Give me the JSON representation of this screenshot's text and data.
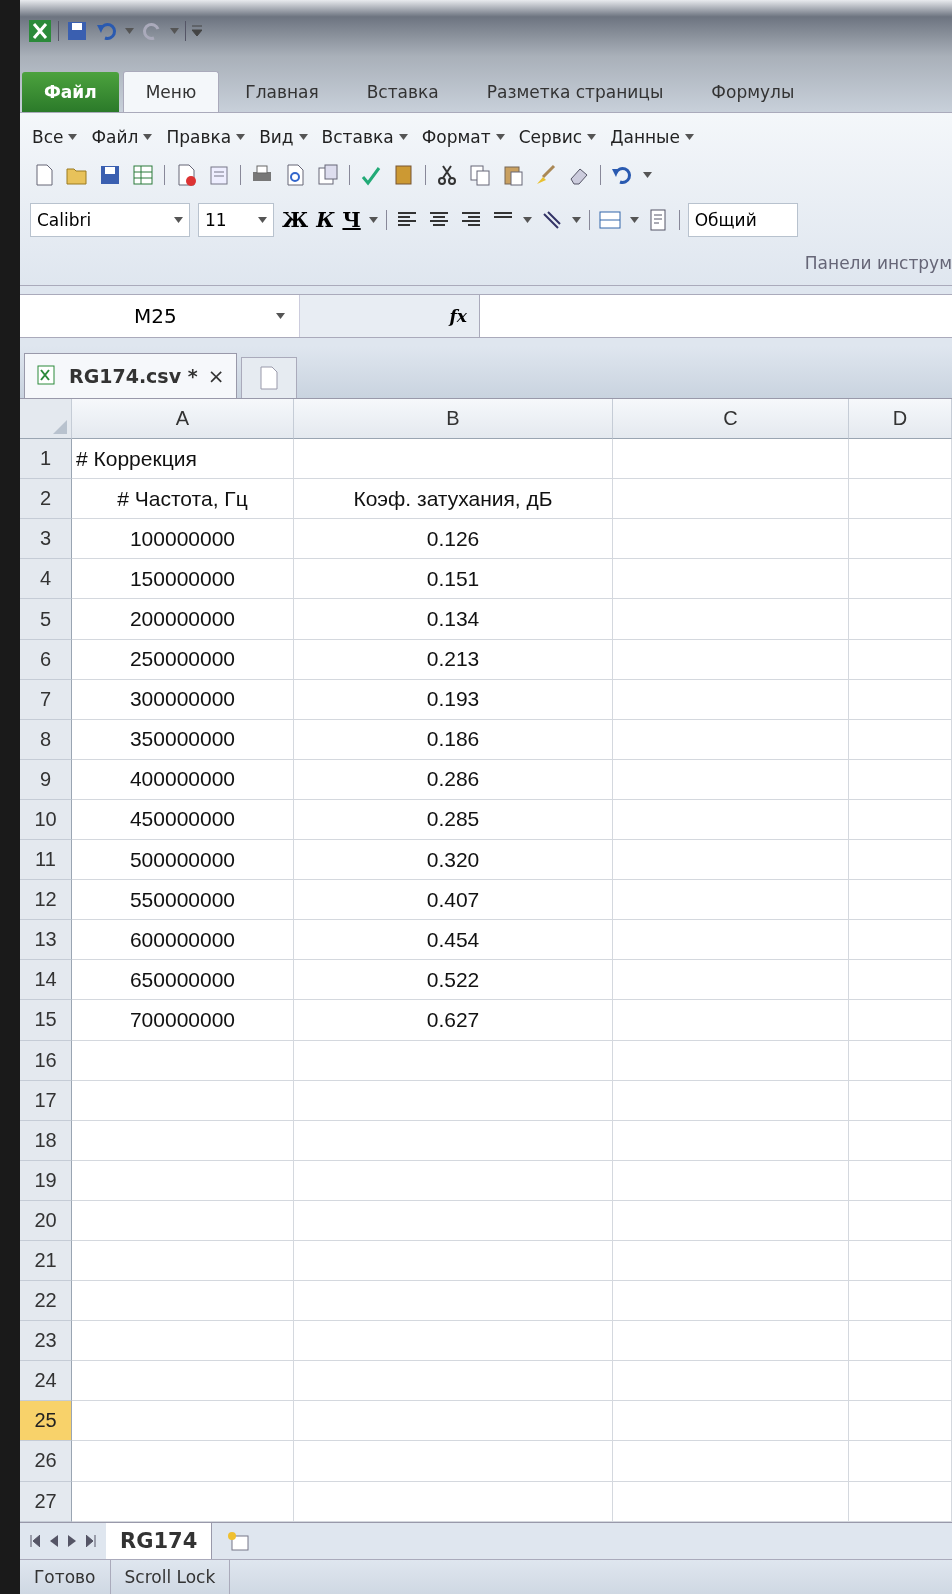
{
  "ribbon_tabs": [
    {
      "label": "Файл",
      "kind": "file",
      "selected": false
    },
    {
      "label": "Меню",
      "kind": "tab",
      "selected": true
    },
    {
      "label": "Главная",
      "kind": "tab",
      "selected": false
    },
    {
      "label": "Вставка",
      "kind": "tab",
      "selected": false
    },
    {
      "label": "Разметка страницы",
      "kind": "tab",
      "selected": false
    },
    {
      "label": "Формулы",
      "kind": "tab",
      "selected": false
    }
  ],
  "menus": [
    "Все",
    "Файл",
    "Правка",
    "Вид",
    "Вставка",
    "Формат",
    "Сервис",
    "Данные"
  ],
  "format_bar": {
    "font": "Calibri",
    "size": "11",
    "bold": "Ж",
    "italic": "К",
    "underline": "Ч",
    "number_format": "Общий"
  },
  "group_label": "Панели инструм",
  "formula_bar": {
    "name_box": "M25",
    "fx": "fx"
  },
  "document_tab": {
    "title": "RG174.csv *",
    "close": "×"
  },
  "columns": [
    {
      "label": "A",
      "selected": false
    },
    {
      "label": "B",
      "selected": false
    },
    {
      "label": "C",
      "selected": false
    },
    {
      "label": "D",
      "selected": false
    }
  ],
  "rows": [
    {
      "number": "1",
      "selected": false,
      "a": "# Коррекция"
    },
    {
      "number": "2",
      "selected": false,
      "a": "# Частота, Гц",
      "b": "Коэф. затухания, дБ"
    },
    {
      "number": "3",
      "selected": false,
      "a": "100000000",
      "b": "0.126"
    },
    {
      "number": "4",
      "selected": false,
      "a": "150000000",
      "b": "0.151"
    },
    {
      "number": "5",
      "selected": false,
      "a": "200000000",
      "b": "0.134"
    },
    {
      "number": "6",
      "selected": false,
      "a": "250000000",
      "b": "0.213"
    },
    {
      "number": "7",
      "selected": false,
      "a": "300000000",
      "b": "0.193"
    },
    {
      "number": "8",
      "selected": false,
      "a": "350000000",
      "b": "0.186"
    },
    {
      "number": "9",
      "selected": false,
      "a": "400000000",
      "b": "0.286"
    },
    {
      "number": "10",
      "selected": false,
      "a": "450000000",
      "b": "0.285"
    },
    {
      "number": "11",
      "selected": false,
      "a": "500000000",
      "b": "0.320"
    },
    {
      "number": "12",
      "selected": false,
      "a": "550000000",
      "b": "0.407"
    },
    {
      "number": "13",
      "selected": false,
      "a": "600000000",
      "b": "0.454"
    },
    {
      "number": "14",
      "selected": false,
      "a": "650000000",
      "b": "0.522"
    },
    {
      "number": "15",
      "selected": false,
      "a": "700000000",
      "b": "0.627"
    },
    {
      "number": "16",
      "selected": false
    },
    {
      "number": "17",
      "selected": false
    },
    {
      "number": "18",
      "selected": false
    },
    {
      "number": "19",
      "selected": false
    },
    {
      "number": "20",
      "selected": false
    },
    {
      "number": "21",
      "selected": false
    },
    {
      "number": "22",
      "selected": false
    },
    {
      "number": "23",
      "selected": false
    },
    {
      "number": "24",
      "selected": false
    },
    {
      "number": "25",
      "selected": true
    },
    {
      "number": "26",
      "selected": false
    },
    {
      "number": "27",
      "selected": false
    }
  ],
  "sheet_tabs": [
    {
      "label": "RG174",
      "selected": true
    }
  ],
  "status_bar": [
    "Готово",
    "Scroll Lock"
  ]
}
